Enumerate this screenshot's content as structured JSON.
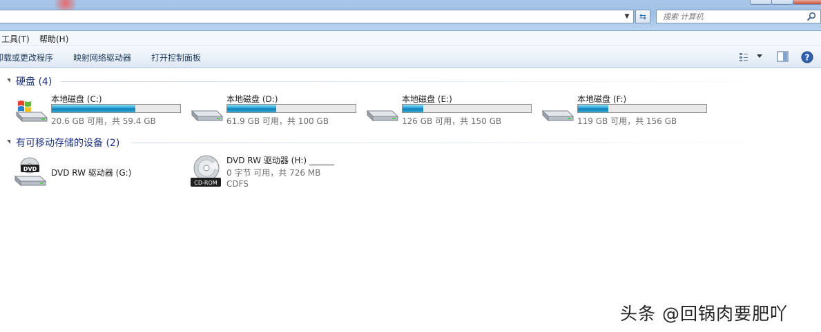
{
  "search": {
    "placeholder": "搜索 计算机"
  },
  "menu": {
    "tools": "工具(T)",
    "help": "帮助(H)"
  },
  "commands": {
    "uninstall": "卸载或更改程序",
    "map_drive": "映射网络驱动器",
    "control_panel": "打开控制面板"
  },
  "groups": {
    "hard_disks": "硬盘 (4)",
    "removable": "有可移动存储的设备 (2)"
  },
  "drives": [
    {
      "name": "本地磁盘 (C:)",
      "info": "20.6 GB 可用，共 59.4 GB",
      "used_fraction": 0.653,
      "icon": "windows-drive-icon"
    },
    {
      "name": "本地磁盘 (D:)",
      "info": "61.9 GB 可用，共 100 GB",
      "used_fraction": 0.381,
      "icon": "hard-drive-icon"
    },
    {
      "name": "本地磁盘 (E:)",
      "info": "126 GB 可用，共 150 GB",
      "used_fraction": 0.16,
      "icon": "hard-drive-icon"
    },
    {
      "name": "本地磁盘 (F:)",
      "info": "119 GB 可用，共 156 GB",
      "used_fraction": 0.237,
      "icon": "hard-drive-icon"
    }
  ],
  "devices": [
    {
      "name": "DVD RW 驱动器 (G:)",
      "icon": "dvd-drive-icon"
    },
    {
      "name": "DVD RW 驱动器 (H:) ______",
      "info": "0 字节 可用，共 726 MB",
      "fs": "CDFS",
      "icon": "cd-rom-icon"
    }
  ],
  "watermark": "头条 @回锅肉要肥吖",
  "colors": {
    "accent": "#26a0da",
    "group_header": "#1e3287"
  }
}
